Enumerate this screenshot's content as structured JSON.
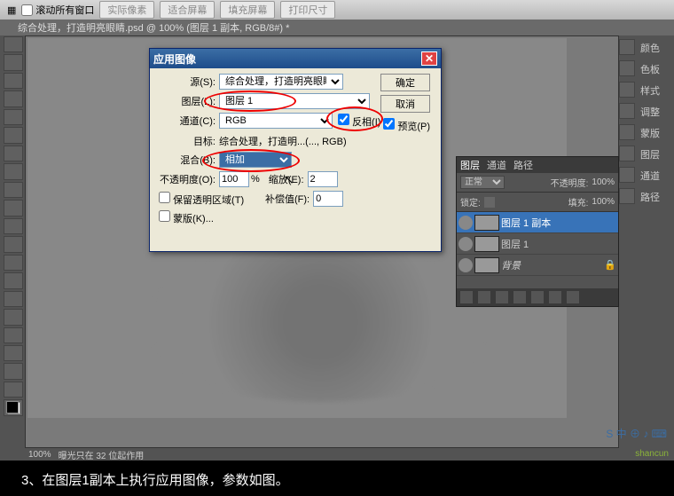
{
  "topbar": {
    "scroll_checkbox": "滚动所有窗口",
    "btn_actual": "实际像素",
    "btn_fit": "适合屏幕",
    "btn_fill": "填充屏幕",
    "btn_print": "打印尺寸"
  },
  "doctab": "综合处理，打造明亮眼睛.psd @ 100% (图层 1 副本, RGB/8#) *",
  "dialog": {
    "title": "应用图像",
    "source_label": "源(S):",
    "source_value": "综合处理，打造明亮眼睛...",
    "layer_label": "图层(L):",
    "layer_value": "图层 1",
    "channel_label": "通道(C):",
    "channel_value": "RGB",
    "invert_label": "反相(I)",
    "target_label": "目标:",
    "target_value": "综合处理，打造明...(..., RGB)",
    "blend_label": "混合(B):",
    "blend_value": "相加",
    "opacity_label": "不透明度(O):",
    "opacity_value": "100",
    "opacity_unit": "%",
    "scale_label": "缩放(E):",
    "scale_value": "2",
    "preserve_label": "保留透明区域(T)",
    "offset_label": "补偿值(F):",
    "offset_value": "0",
    "mask_label": "蒙版(K)...",
    "ok": "确定",
    "cancel": "取消",
    "preview_label": "预览(P)"
  },
  "right_panel": {
    "color": "颜色",
    "swatch": "色板",
    "styles": "样式",
    "adjust": "调整",
    "masks": "蒙版",
    "layers": "图层",
    "channels": "通道",
    "paths": "路径"
  },
  "layers_panel": {
    "tab_layers": "图层",
    "tab_channels": "通道",
    "tab_paths": "路径",
    "mode": "正常",
    "opacity_lbl": "不透明度:",
    "opacity_val": "100%",
    "lock_lbl": "锁定:",
    "fill_lbl": "填充:",
    "fill_val": "100%",
    "items": [
      {
        "name": "图层 1 副本"
      },
      {
        "name": "图层 1"
      },
      {
        "name": "背景"
      }
    ]
  },
  "status": {
    "zoom": "100%",
    "info": "曝光只在 32 位起作用"
  },
  "caption": "3、在图层1副本上执行应用图像，参数如图。",
  "watermark": "shancun"
}
